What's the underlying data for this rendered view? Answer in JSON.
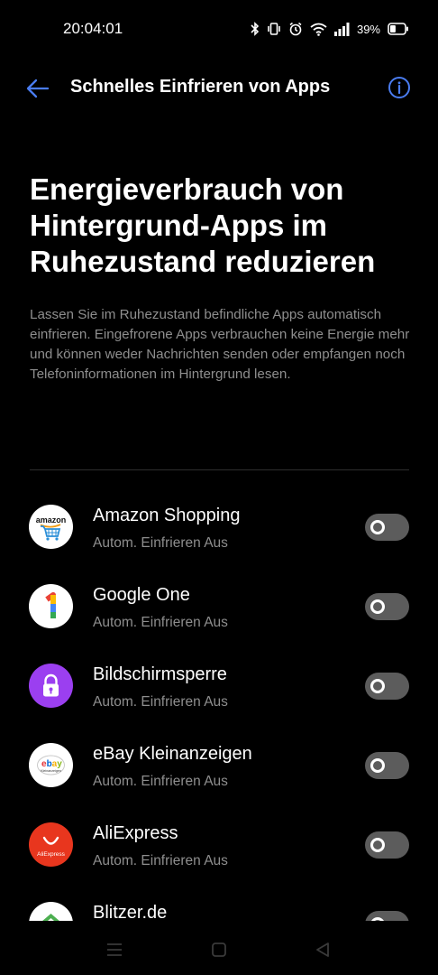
{
  "status_bar": {
    "time": "20:04:01",
    "battery_percent": "39%",
    "icons": [
      "bluetooth-icon",
      "vibrate-icon",
      "alarm-icon",
      "wifi-icon",
      "signal-icon",
      "battery-icon"
    ],
    "battery_level": 0.39
  },
  "toolbar": {
    "title": "Schnelles Einfrieren von Apps",
    "back_icon": "arrow-left-icon",
    "info_icon": "info-icon",
    "accent_color": "#4a7cf0"
  },
  "header": {
    "headline": "Energieverbrauch von Hintergrund-Apps im Ruhezustand reduzieren",
    "description": "Lassen Sie im Ruhezustand befindliche Apps automatisch einfrieren. Eingefrorene Apps verbrauchen keine Energie mehr und können weder Nachrichten senden oder empfangen noch Telefoninformationen im Hintergrund lesen."
  },
  "apps": [
    {
      "name": "Amazon Shopping",
      "status": "Autom. Einfrieren Aus",
      "enabled": false,
      "icon": "amazon-icon",
      "icon_text": "amazon"
    },
    {
      "name": "Google One",
      "status": "Autom. Einfrieren Aus",
      "enabled": false,
      "icon": "google-one-icon",
      "icon_text": "1"
    },
    {
      "name": "Bildschirmsperre",
      "status": "Autom. Einfrieren Aus",
      "enabled": false,
      "icon": "lock-icon",
      "icon_text": ""
    },
    {
      "name": "eBay Kleinanzeigen",
      "status": "Autom. Einfrieren Aus",
      "enabled": false,
      "icon": "ebay-icon",
      "icon_text": "ebay",
      "icon_subtext": "Kleinanzeigen"
    },
    {
      "name": "AliExpress",
      "status": "Autom. Einfrieren Aus",
      "enabled": false,
      "icon": "aliexpress-icon",
      "icon_text": "AliExpress"
    },
    {
      "name": "Blitzer.de",
      "status": "",
      "enabled": false,
      "icon": "blitzer-icon",
      "icon_text": ""
    }
  ],
  "nav_bar": {
    "buttons": [
      "menu-icon",
      "home-icon",
      "back-triangle-icon"
    ]
  }
}
